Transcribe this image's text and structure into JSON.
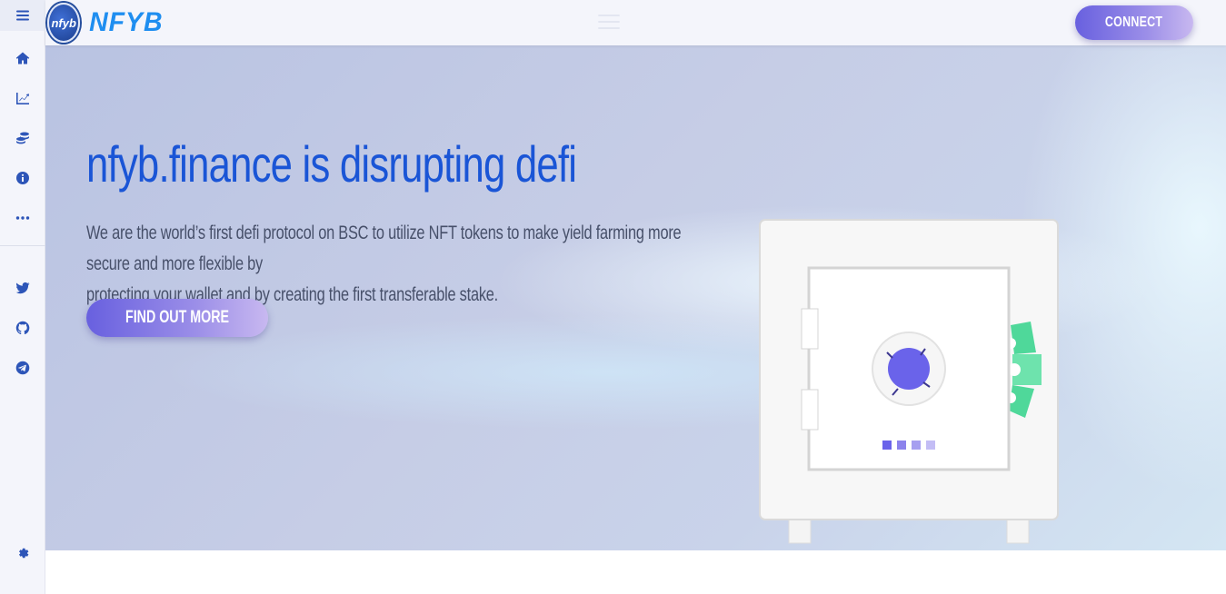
{
  "header": {
    "logo_text": "NFYB",
    "logo_mark_text": "nfyb",
    "connect_label": "CONNECT"
  },
  "sidebar": {
    "items": [
      {
        "name": "menu",
        "icon": "bars-icon"
      },
      {
        "name": "home",
        "icon": "home-icon"
      },
      {
        "name": "chart",
        "icon": "chart-line-icon"
      },
      {
        "name": "coins",
        "icon": "coins-icon"
      },
      {
        "name": "info",
        "icon": "info-icon"
      },
      {
        "name": "more",
        "icon": "ellipsis-icon"
      },
      {
        "name": "twitter",
        "icon": "twitter-icon"
      },
      {
        "name": "github",
        "icon": "github-icon"
      },
      {
        "name": "telegram",
        "icon": "telegram-icon"
      },
      {
        "name": "settings",
        "icon": "gear-icon"
      }
    ]
  },
  "hero": {
    "title": "nfyb.finance is disrupting defi",
    "description_line1": "We are the world’s first defi protocol on BSC to utilize NFT tokens to make yield farming more secure and more flexible by",
    "description_line2": "protecting your wallet and by creating the first transferable stake.",
    "cta_label": "FIND OUT MORE"
  },
  "colors": {
    "accent": "#1a55d6",
    "button_gradient_start": "#6860df",
    "button_gradient_end": "#c8b8f0",
    "sidebar_icon": "#2d55b8"
  }
}
